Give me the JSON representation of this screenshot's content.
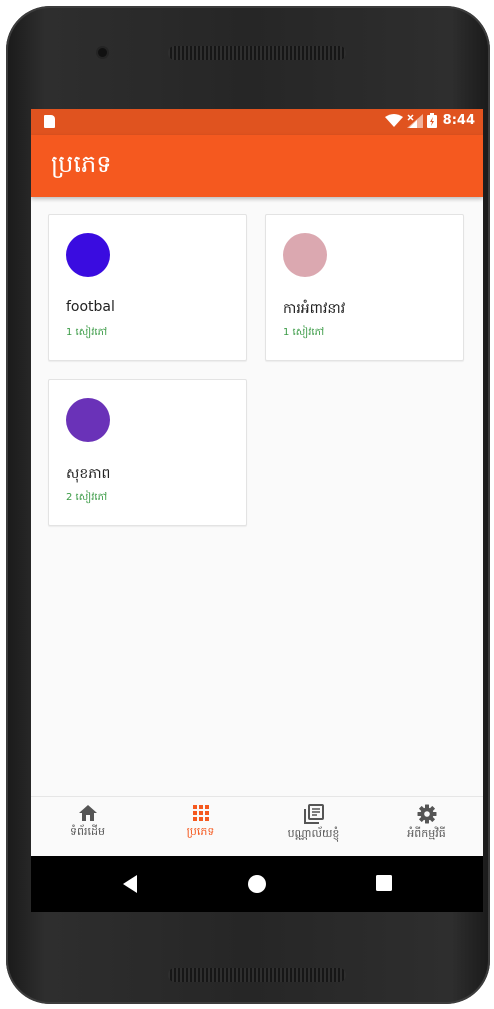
{
  "status_bar": {
    "time": "8:44"
  },
  "app_bar": {
    "title": "ប្រភេទ"
  },
  "categories": [
    {
      "name": "footbal",
      "count": "1 សៀវភៅ",
      "color": "#3a0ce0"
    },
    {
      "name": "ការអំពាវនាវ",
      "count": "1 សៀវភៅ",
      "color": "#dba8b0"
    },
    {
      "name": "សុខភាព",
      "count": "2 សៀវភៅ",
      "color": "#6a32b8"
    }
  ],
  "bottom_nav": {
    "items": [
      {
        "label": "ទំព័រដើម",
        "icon": "home-icon"
      },
      {
        "label": "ប្រភេទ",
        "icon": "grid-icon",
        "active": true
      },
      {
        "label": "បណ្ណាល័យខ្ញុំ",
        "icon": "library-icon"
      },
      {
        "label": "អំពីកម្មវិធី",
        "icon": "gear-icon"
      }
    ]
  },
  "colors": {
    "primary": "#f5591f",
    "status_bar": "#e0531f",
    "count_text": "#3b9b46"
  }
}
